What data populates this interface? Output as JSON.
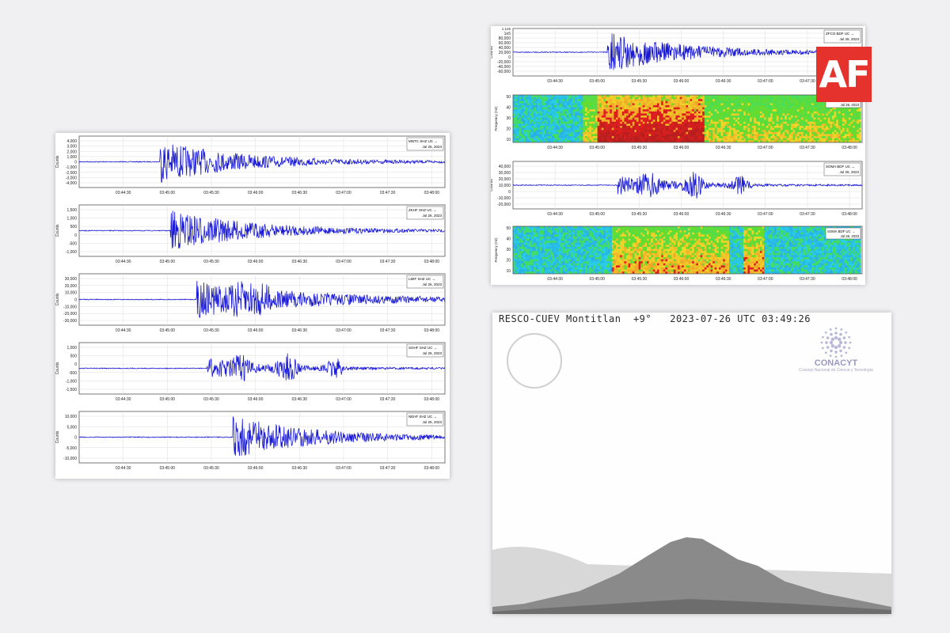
{
  "left_panel": {
    "ylabel": "Counts",
    "x_ticks": [
      "03:44:30",
      "03:45:00",
      "03:45:30",
      "03:46:00",
      "03:46:30",
      "03:47:00",
      "03:47:30",
      "03:48:00"
    ],
    "tracks": [
      {
        "station": "MNTC SHZ UC",
        "date": "Jul 26, 2023",
        "yticks": [
          "4,000",
          "3,000",
          "2,000",
          "1,000",
          "0",
          "-1,000",
          "-2,000",
          "-3,000",
          "-4,000"
        ],
        "onset": 0.22,
        "shape": "single"
      },
      {
        "station": "ZKHF SHZ UC",
        "date": "Jul 26, 2023",
        "yticks": [
          "1,500",
          "1,000",
          "500",
          "0",
          "-500",
          "-1,000"
        ],
        "onset": 0.25,
        "shape": "single"
      },
      {
        "station": "LMIF SHZ UC",
        "date": "Jul 26, 2023",
        "yticks": [
          "30,000",
          "20,000",
          "10,000",
          "0",
          "-10,000",
          "-20,000",
          "-30,000"
        ],
        "onset": 0.32,
        "shape": "double"
      },
      {
        "station": "SOHF SHZ UC",
        "date": "Jul 26, 2023",
        "yticks": [
          "1,000",
          "500",
          "0",
          "-500",
          "-1,000",
          "-1,500"
        ],
        "onset": 0.35,
        "shape": "triple"
      },
      {
        "station": "NEHF SHZ UC",
        "date": "Jul 26, 2023",
        "yticks": [
          "10,000",
          "5,000",
          "0",
          "-5,000",
          "-10,000"
        ],
        "onset": 0.42,
        "shape": "single"
      }
    ]
  },
  "right_panel": {
    "x_ticks": [
      "03:44:30",
      "03:45:00",
      "03:45:30",
      "03:46:00",
      "03:46:30",
      "03:47:00",
      "03:47:30",
      "03:48:00"
    ],
    "seismo1": {
      "station": "ZFCO BDF UC",
      "date": "Jul 26, 2023",
      "ylabel": "Counts",
      "yticks": [
        "1e5",
        "80,000",
        "60,000",
        "40,000",
        "20,000",
        "0",
        "-20,000",
        "-40,000",
        "-60,000"
      ],
      "topnote": "1.1e5"
    },
    "spec1": {
      "station": "ZFCO BDF UC",
      "date": "Jul 26, 2023",
      "ylabel": "Frequency (Hz)",
      "yticks": [
        "50",
        "40",
        "30",
        "20",
        "10"
      ]
    },
    "seismo2": {
      "station": "SOMA BDF UC",
      "date": "Jul 26, 2023",
      "ylabel": "Counts",
      "yticks": [
        "40,000",
        "30,000",
        "20,000",
        "10,000",
        "0",
        "-10,000",
        "-20,000"
      ]
    },
    "spec2": {
      "station": "SOMA BDF UC",
      "date": "Jul 26, 2023",
      "ylabel": "Frequency (Hz)",
      "yticks": [
        "50",
        "40",
        "30",
        "20",
        "10"
      ]
    }
  },
  "camera": {
    "overlay": "RESCO-CUEV Montitlan  +9°   2023-07-26 UTC 03:49:26",
    "brand": "CONACYT",
    "brand_sub": "Consejo Nacional de Ciencia y Tecnología"
  },
  "af_logo": "AF",
  "chart_data": [
    {
      "type": "line",
      "title": "",
      "series": [
        {
          "name": "MNTC SHZ UC",
          "values": []
        }
      ],
      "xlabel": "",
      "ylabel": "Counts",
      "x_ticks": [
        "03:44:30",
        "03:45:00",
        "03:45:30",
        "03:46:00",
        "03:46:30",
        "03:47:00",
        "03:47:30",
        "03:48:00"
      ],
      "ylim": [
        -4500,
        4500
      ]
    },
    {
      "type": "line",
      "title": "",
      "series": [
        {
          "name": "ZKHF SHZ UC",
          "values": []
        }
      ],
      "ylabel": "Counts",
      "ylim": [
        -1500,
        1700
      ]
    },
    {
      "type": "line",
      "title": "",
      "series": [
        {
          "name": "LMIF SHZ UC",
          "values": []
        }
      ],
      "ylabel": "Counts",
      "ylim": [
        -35000,
        35000
      ]
    },
    {
      "type": "line",
      "title": "",
      "series": [
        {
          "name": "SOHF SHZ UC",
          "values": []
        }
      ],
      "ylabel": "Counts",
      "ylim": [
        -1700,
        1300
      ]
    },
    {
      "type": "line",
      "title": "",
      "series": [
        {
          "name": "NEHF SHZ UC",
          "values": []
        }
      ],
      "ylabel": "Counts",
      "ylim": [
        -13000,
        13000
      ]
    },
    {
      "type": "heatmap",
      "title": "",
      "series": [
        {
          "name": "ZFCO BDF UC"
        }
      ],
      "ylabel": "Frequency (Hz)",
      "ylim": [
        0,
        50
      ]
    },
    {
      "type": "heatmap",
      "title": "",
      "series": [
        {
          "name": "SOMA BDF UC"
        }
      ],
      "ylabel": "Frequency (Hz)",
      "ylim": [
        0,
        50
      ]
    }
  ]
}
